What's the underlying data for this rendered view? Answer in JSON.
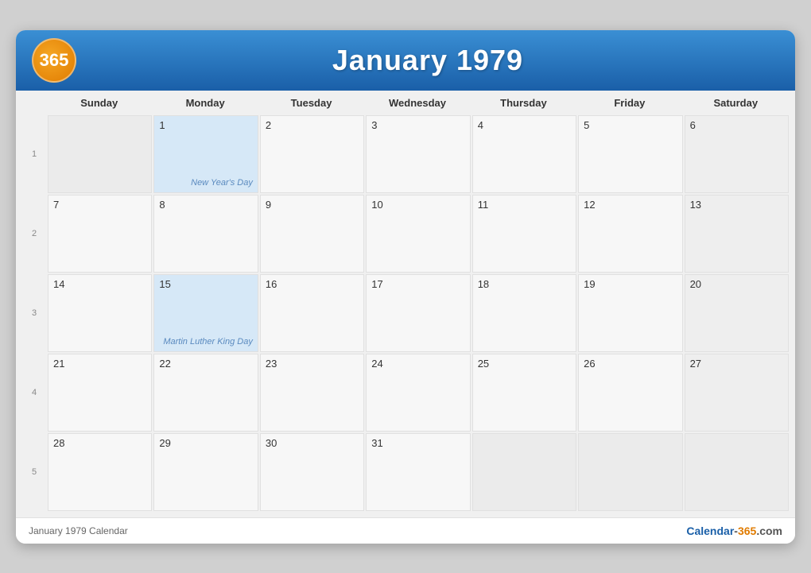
{
  "header": {
    "logo": "365",
    "title": "January 1979"
  },
  "day_headers": [
    "Sunday",
    "Monday",
    "Tuesday",
    "Wednesday",
    "Thursday",
    "Friday",
    "Saturday"
  ],
  "weeks": [
    {
      "week_num": "1",
      "days": [
        {
          "date": "",
          "type": "empty"
        },
        {
          "date": "1",
          "type": "holiday",
          "holiday": "New Year's Day"
        },
        {
          "date": "2",
          "type": "normal"
        },
        {
          "date": "3",
          "type": "normal"
        },
        {
          "date": "4",
          "type": "normal"
        },
        {
          "date": "5",
          "type": "normal"
        },
        {
          "date": "6",
          "type": "saturday"
        }
      ]
    },
    {
      "week_num": "2",
      "days": [
        {
          "date": "7",
          "type": "normal"
        },
        {
          "date": "8",
          "type": "normal"
        },
        {
          "date": "9",
          "type": "normal"
        },
        {
          "date": "10",
          "type": "normal"
        },
        {
          "date": "11",
          "type": "normal"
        },
        {
          "date": "12",
          "type": "normal"
        },
        {
          "date": "13",
          "type": "saturday"
        }
      ]
    },
    {
      "week_num": "3",
      "days": [
        {
          "date": "14",
          "type": "normal"
        },
        {
          "date": "15",
          "type": "holiday",
          "holiday": "Martin Luther King Day"
        },
        {
          "date": "16",
          "type": "normal"
        },
        {
          "date": "17",
          "type": "normal"
        },
        {
          "date": "18",
          "type": "normal"
        },
        {
          "date": "19",
          "type": "normal"
        },
        {
          "date": "20",
          "type": "saturday"
        }
      ]
    },
    {
      "week_num": "4",
      "days": [
        {
          "date": "21",
          "type": "normal"
        },
        {
          "date": "22",
          "type": "normal"
        },
        {
          "date": "23",
          "type": "normal"
        },
        {
          "date": "24",
          "type": "normal"
        },
        {
          "date": "25",
          "type": "normal"
        },
        {
          "date": "26",
          "type": "normal"
        },
        {
          "date": "27",
          "type": "saturday"
        }
      ]
    },
    {
      "week_num": "5",
      "days": [
        {
          "date": "28",
          "type": "normal"
        },
        {
          "date": "29",
          "type": "normal"
        },
        {
          "date": "30",
          "type": "normal"
        },
        {
          "date": "31",
          "type": "normal"
        },
        {
          "date": "",
          "type": "empty"
        },
        {
          "date": "",
          "type": "empty"
        },
        {
          "date": "",
          "type": "empty"
        }
      ]
    }
  ],
  "footer": {
    "left": "January 1979 Calendar",
    "right": "Calendar-365.com"
  }
}
